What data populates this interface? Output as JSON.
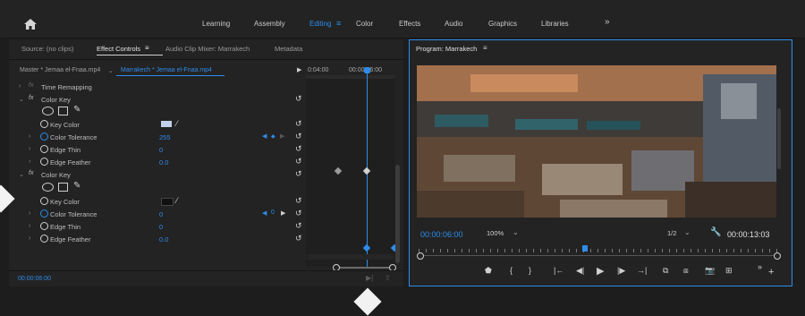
{
  "workspaces": [
    "Learning",
    "Assembly",
    "Editing",
    "Color",
    "Effects",
    "Audio",
    "Graphics",
    "Libraries"
  ],
  "active_workspace": "Editing",
  "more_workspaces": "»",
  "left_tabs": [
    "Source: (no clips)",
    "Effect Controls",
    "Audio Clip Mixer: Marrakech",
    "Metadata"
  ],
  "ec": {
    "master_clip": "Master * Jemaa el-Fnaa.mp4",
    "seq_clip": "Marrakech * Jemaa el-Fnaa.mp4",
    "time_start": "0:04:00",
    "time_end": "00:00:06:00",
    "rows": {
      "time_remap": "Time Remapping",
      "color_key_1": "Color Key",
      "key_color": "Key Color",
      "color_tolerance": "Color Tolerance",
      "tolerance_1": "255",
      "edge_thin": "Edge Thin",
      "edge_thin_1": "0",
      "edge_feather": "Edge Feather",
      "edge_feather_1": "0.0",
      "color_key_2": "Color Key",
      "tolerance_2": "0",
      "kf_value": "0",
      "edge_thin_2": "0",
      "edge_feather_2": "0.0"
    },
    "current_time": "00:00:06:00"
  },
  "program": {
    "title": "Program: Marrakech",
    "timecode": "00:00:06:00",
    "zoom": "100%",
    "resolution": "1/2",
    "duration": "00:00:13:03",
    "playhead_fraction": 0.46
  },
  "colors": {
    "accent": "#2d8ceb",
    "panel": "#232323",
    "bg": "#1d1d1d"
  }
}
